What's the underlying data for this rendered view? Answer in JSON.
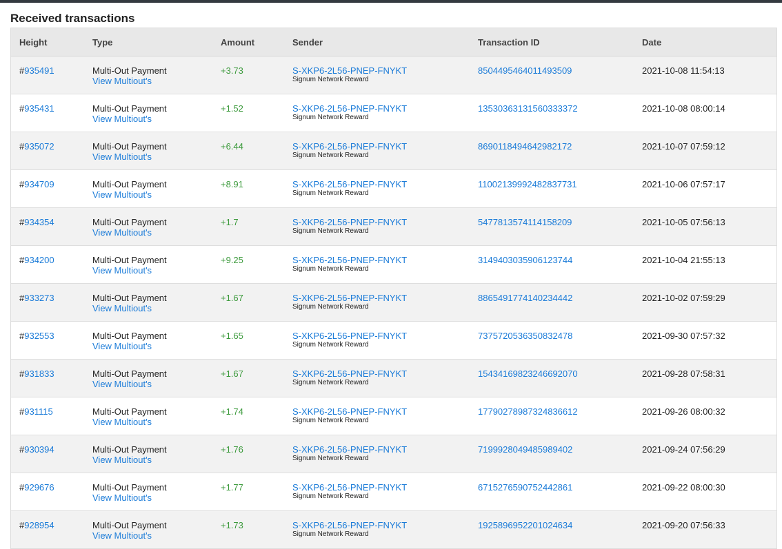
{
  "title": "Received transactions",
  "columns": {
    "height": "Height",
    "type": "Type",
    "amount": "Amount",
    "sender": "Sender",
    "txid": "Transaction ID",
    "date": "Date"
  },
  "rows": [
    {
      "hash": "#",
      "height": "935491",
      "type": "Multi-Out Payment",
      "link": "View Multiout's",
      "amount": "+3.73",
      "sender": "S-XKP6-2L56-PNEP-FNYKT",
      "sender_note": "Signum Network Reward",
      "txid": "8504495464011493509",
      "date": "2021-10-08 11:54:13"
    },
    {
      "hash": "#",
      "height": "935431",
      "type": "Multi-Out Payment",
      "link": "View Multiout's",
      "amount": "+1.52",
      "sender": "S-XKP6-2L56-PNEP-FNYKT",
      "sender_note": "Signum Network Reward",
      "txid": "13530363131560333372",
      "date": "2021-10-08 08:00:14"
    },
    {
      "hash": "#",
      "height": "935072",
      "type": "Multi-Out Payment",
      "link": "View Multiout's",
      "amount": "+6.44",
      "sender": "S-XKP6-2L56-PNEP-FNYKT",
      "sender_note": "Signum Network Reward",
      "txid": "8690118494642982172",
      "date": "2021-10-07 07:59:12"
    },
    {
      "hash": "#",
      "height": "934709",
      "type": "Multi-Out Payment",
      "link": "View Multiout's",
      "amount": "+8.91",
      "sender": "S-XKP6-2L56-PNEP-FNYKT",
      "sender_note": "Signum Network Reward",
      "txid": "11002139992482837731",
      "date": "2021-10-06 07:57:17"
    },
    {
      "hash": "#",
      "height": "934354",
      "type": "Multi-Out Payment",
      "link": "View Multiout's",
      "amount": "+1.7",
      "sender": "S-XKP6-2L56-PNEP-FNYKT",
      "sender_note": "Signum Network Reward",
      "txid": "5477813574114158209",
      "date": "2021-10-05 07:56:13"
    },
    {
      "hash": "#",
      "height": "934200",
      "type": "Multi-Out Payment",
      "link": "View Multiout's",
      "amount": "+9.25",
      "sender": "S-XKP6-2L56-PNEP-FNYKT",
      "sender_note": "Signum Network Reward",
      "txid": "3149403035906123744",
      "date": "2021-10-04 21:55:13"
    },
    {
      "hash": "#",
      "height": "933273",
      "type": "Multi-Out Payment",
      "link": "View Multiout's",
      "amount": "+1.67",
      "sender": "S-XKP6-2L56-PNEP-FNYKT",
      "sender_note": "Signum Network Reward",
      "txid": "8865491774140234442",
      "date": "2021-10-02 07:59:29"
    },
    {
      "hash": "#",
      "height": "932553",
      "type": "Multi-Out Payment",
      "link": "View Multiout's",
      "amount": "+1.65",
      "sender": "S-XKP6-2L56-PNEP-FNYKT",
      "sender_note": "Signum Network Reward",
      "txid": "7375720536350832478",
      "date": "2021-09-30 07:57:32"
    },
    {
      "hash": "#",
      "height": "931833",
      "type": "Multi-Out Payment",
      "link": "View Multiout's",
      "amount": "+1.67",
      "sender": "S-XKP6-2L56-PNEP-FNYKT",
      "sender_note": "Signum Network Reward",
      "txid": "15434169823246692070",
      "date": "2021-09-28 07:58:31"
    },
    {
      "hash": "#",
      "height": "931115",
      "type": "Multi-Out Payment",
      "link": "View Multiout's",
      "amount": "+1.74",
      "sender": "S-XKP6-2L56-PNEP-FNYKT",
      "sender_note": "Signum Network Reward",
      "txid": "17790278987324836612",
      "date": "2021-09-26 08:00:32"
    },
    {
      "hash": "#",
      "height": "930394",
      "type": "Multi-Out Payment",
      "link": "View Multiout's",
      "amount": "+1.76",
      "sender": "S-XKP6-2L56-PNEP-FNYKT",
      "sender_note": "Signum Network Reward",
      "txid": "7199928049485989402",
      "date": "2021-09-24 07:56:29"
    },
    {
      "hash": "#",
      "height": "929676",
      "type": "Multi-Out Payment",
      "link": "View Multiout's",
      "amount": "+1.77",
      "sender": "S-XKP6-2L56-PNEP-FNYKT",
      "sender_note": "Signum Network Reward",
      "txid": "6715276590752442861",
      "date": "2021-09-22 08:00:30"
    },
    {
      "hash": "#",
      "height": "928954",
      "type": "Multi-Out Payment",
      "link": "View Multiout's",
      "amount": "+1.73",
      "sender": "S-XKP6-2L56-PNEP-FNYKT",
      "sender_note": "Signum Network Reward",
      "txid": "1925896952201024634",
      "date": "2021-09-20 07:56:33"
    }
  ]
}
